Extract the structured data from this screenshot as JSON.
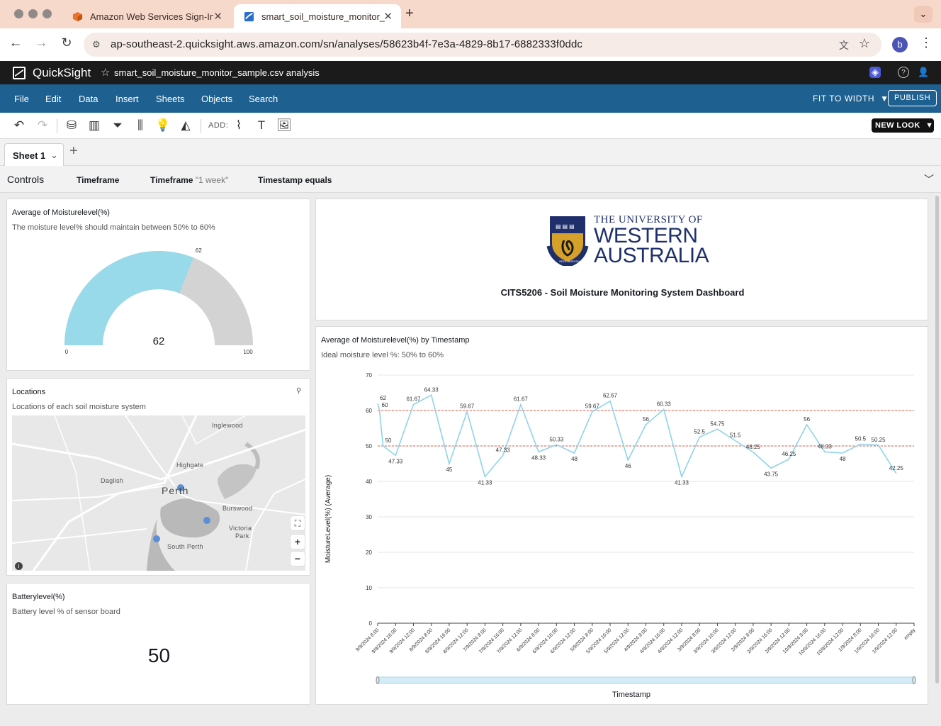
{
  "browser": {
    "tabs": [
      {
        "title": "Amazon Web Services Sign-In",
        "active": false
      },
      {
        "title": "smart_soil_moisture_monitor_sample.csv analysis",
        "active": true
      }
    ],
    "url": "ap-southeast-2.quicksight.aws.amazon.com/sn/analyses/58623b4f-7e3a-4829-8b17-6882333f0ddc",
    "profile_initial": "b"
  },
  "app": {
    "name": "QuickSight",
    "analysis_title": "smart_soil_moisture_monitor_sample.csv analysis",
    "menu": [
      "File",
      "Edit",
      "Data",
      "Insert",
      "Sheets",
      "Objects",
      "Search"
    ],
    "fit_label": "FIT TO WIDTH",
    "publish_label": "PUBLISH",
    "add_label": "ADD:",
    "new_look_label": "NEW LOOK",
    "sheet_tab": "Sheet 1"
  },
  "controls": {
    "label": "Controls",
    "items": [
      {
        "name": "Timeframe",
        "value": ""
      },
      {
        "name": "Timeframe",
        "value": "\"1 week\""
      },
      {
        "name": "Timestamp equals",
        "value": ""
      }
    ]
  },
  "gauge": {
    "title": "Average of Moisturelevel(%)",
    "subtitle": "The moisture level% should maintain between 50% to 60%",
    "value": 62,
    "value_label": "62",
    "min": 0,
    "max": 100,
    "min_label": "0",
    "max_label": "100",
    "fill_color": "#98d9ea",
    "track_color": "#d3d3d3"
  },
  "map": {
    "title": "Locations",
    "subtitle": "Locations of each soil moisture system",
    "labels": [
      "Inglewood",
      "Highgate",
      "Daglish",
      "Perth",
      "Burswood",
      "Victoria",
      "Park",
      "South Perth"
    ],
    "point_color": "#5b8fd6"
  },
  "battery": {
    "title": "Batterylevel(%)",
    "subtitle": "Battery level % of sensor board",
    "value": "50"
  },
  "header_card": {
    "logo_lines": [
      "THE UNIVERSITY OF",
      "WESTERN",
      "AUSTRALIA"
    ],
    "crest_motto": "SEEK WISDOM",
    "dashboard_title": "CITS5206 - Soil Moisture Monitoring System Dashboard"
  },
  "chart_data": {
    "type": "line",
    "title": "Average of Moisturelevel(%) by Timestamp",
    "subtitle": "Ideal moisture level %: 50% to 60%",
    "xlabel": "Timestamp",
    "ylabel": "MoistureLevel(%) (Average)",
    "ylim": [
      0,
      70
    ],
    "yticks": [
      0,
      10,
      20,
      30,
      40,
      50,
      60,
      70
    ],
    "reference_lines": [
      60,
      50
    ],
    "line_color": "#8fd3ea",
    "reference_color": "#e05a47",
    "grid": true,
    "x_tick_labels": [
      "9/9/2024 8:00",
      "9/9/2024 16:00",
      "9/9/2024 12:00",
      "8/9/2024 8:00",
      "8/9/2024 16:00",
      "8/9/2024 12:00",
      "7/9/2024 8:00",
      "7/9/2024 16:00",
      "7/9/2024 12:00",
      "6/9/2024 8:00",
      "6/9/2024 16:00",
      "6/9/2024 12:00",
      "5/9/2024 8:00",
      "5/9/2024 16:00",
      "5/9/2024 12:00",
      "4/9/2024 8:00",
      "4/9/2024 16:00",
      "4/9/2024 12:00",
      "3/9/2024 8:00",
      "3/9/2024 16:00",
      "3/9/2024 12:00",
      "2/9/2024 8:00",
      "2/9/2024 16:00",
      "2/9/2024 12:00",
      "10/9/2024 8:00",
      "10/9/2024 16:00",
      "10/9/2024 12:00",
      "1/9/2024 8:00",
      "1/9/2024 16:00",
      "1/9/2024 12:00",
      "empty"
    ],
    "points": [
      {
        "x": 0,
        "y": 62,
        "label": "62"
      },
      {
        "x": 0.1,
        "y": 60,
        "label": "60"
      },
      {
        "x": 0.3,
        "y": 50,
        "label": "50"
      },
      {
        "x": 1,
        "y": 47.33,
        "label": "47.33"
      },
      {
        "x": 2,
        "y": 61.67,
        "label": "61.67"
      },
      {
        "x": 3,
        "y": 64.33,
        "label": "64.33"
      },
      {
        "x": 4,
        "y": 45,
        "label": "45"
      },
      {
        "x": 5,
        "y": 59.67,
        "label": "59.67"
      },
      {
        "x": 6,
        "y": 41.33,
        "label": "41.33"
      },
      {
        "x": 7,
        "y": 47.33,
        "label": "47.33"
      },
      {
        "x": 8,
        "y": 61.67,
        "label": "61.67"
      },
      {
        "x": 9,
        "y": 48.33,
        "label": "48.33"
      },
      {
        "x": 10,
        "y": 50.33,
        "label": "50.33"
      },
      {
        "x": 11,
        "y": 48,
        "label": "48"
      },
      {
        "x": 12,
        "y": 59.67,
        "label": "59.67"
      },
      {
        "x": 13,
        "y": 62.67,
        "label": "62.67"
      },
      {
        "x": 14,
        "y": 46,
        "label": "46"
      },
      {
        "x": 15,
        "y": 56,
        "label": "56"
      },
      {
        "x": 16,
        "y": 60.33,
        "label": "60.33"
      },
      {
        "x": 17,
        "y": 41.33,
        "label": "41.33"
      },
      {
        "x": 18,
        "y": 52.5,
        "label": "52.5"
      },
      {
        "x": 19,
        "y": 54.75,
        "label": "54.75"
      },
      {
        "x": 20,
        "y": 51.5,
        "label": "51.5"
      },
      {
        "x": 21,
        "y": 48.25,
        "label": "48.25"
      },
      {
        "x": 22,
        "y": 43.75,
        "label": "43.75"
      },
      {
        "x": 23,
        "y": 46.25,
        "label": "46.25"
      },
      {
        "x": 24,
        "y": 56,
        "label": "56"
      },
      {
        "x": 25,
        "y": 48.33,
        "label": "48.33"
      },
      {
        "x": 26,
        "y": 48,
        "label": "48"
      },
      {
        "x": 27,
        "y": 50.5,
        "label": "50.5"
      },
      {
        "x": 28,
        "y": 50.25,
        "label": "50.25"
      },
      {
        "x": 29,
        "y": 42.25,
        "label": "42.25"
      }
    ]
  }
}
